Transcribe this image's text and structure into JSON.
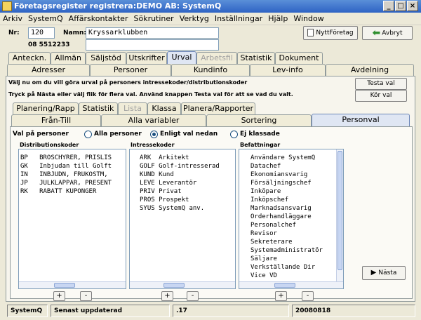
{
  "window": {
    "title": "Företagsregister registrera:DEMO AB: SystemQ",
    "min": "_",
    "max": "□",
    "close": "×"
  },
  "menu": [
    "Arkiv",
    "SystemQ",
    "Affärskontakter",
    "Sökrutiner",
    "Verktyg",
    "Inställningar",
    "Hjälp",
    "Window"
  ],
  "header": {
    "nr_label": "Nr:",
    "nr_value": "120",
    "phone": "08 5512233",
    "namn_label": "Namn:",
    "namn_value": "Kryssarklubben",
    "namn2_value": "",
    "new_button": "NyttFöretag",
    "cancel_button": "Avbryt"
  },
  "tabs_row1": [
    "Anteckn.",
    "Allmän",
    "Säljstöd",
    "Utskrifter",
    "Urval",
    "Arbetsfil",
    "Statistik",
    "Dokument"
  ],
  "tabs_row2": [
    "Adresser",
    "Personer",
    "Kundinfo",
    "Lev-info",
    "Avdelning"
  ],
  "info": {
    "line1": "Välj nu om du vill göra urval på personers intressekoder/distributionskoder",
    "line2": "Tryck på Nästa eller välj flik för flera val. Använd knappen Testa val för att se vad du valt.",
    "test_button": "Testa val",
    "run_button": "Kör val"
  },
  "tabs_row3": [
    "Planering/Rapp",
    "Statistik",
    "Lista",
    "Klassa",
    "Planera/Rapporter"
  ],
  "tabs_row4": [
    "Från-Till",
    "Alla variabler",
    "Sortering",
    "Personval"
  ],
  "personval": {
    "label": "Val på personer",
    "opt1": "Alla personer",
    "opt2": "Enligt val nedan",
    "opt3": "Ej klassade",
    "selected": "Enligt val nedan"
  },
  "lists": {
    "dist_header": "Distributionskoder",
    "dist": [
      "BP   BROSCHYRER, PRISLIS",
      "GK   Inbjudan till Golft",
      "IN   INBJUDN, FRUKOSTM,",
      "JP   JULKLAPPAR, PRESENT",
      "RK   RABATT KUPONGER"
    ],
    "intr_header": "Intressekoder",
    "intr": [
      "ARK  Arkitekt",
      "GOLF Golf-intresserad",
      "KUND Kund",
      "LEVE Leverantör",
      "PRIV Privat",
      "PROS Prospekt",
      "SYUS SystemQ anv."
    ],
    "bef_header": "Befattningar",
    "bef": [
      "Användare SystemQ",
      "Datachef",
      "Ekonomiansvarig",
      "Försäljningschef",
      "Inköpare",
      "Inköpschef",
      "Marknadsansvarig",
      "Orderhandläggare",
      "Personalchef",
      "Revisor",
      "Sekreterare",
      "Systemadministratör",
      "Säljare",
      "Verkställande Dir",
      "Vice VD"
    ],
    "plus": "+",
    "minus": "-"
  },
  "next_button": "Nästa",
  "statusbar": [
    "SystemQ",
    "Senast uppdaterad",
    ".17",
    "20080818"
  ],
  "colors": {
    "title": "#2e63c4",
    "accent": "#6b86b8",
    "green": "#2f8f2f"
  }
}
